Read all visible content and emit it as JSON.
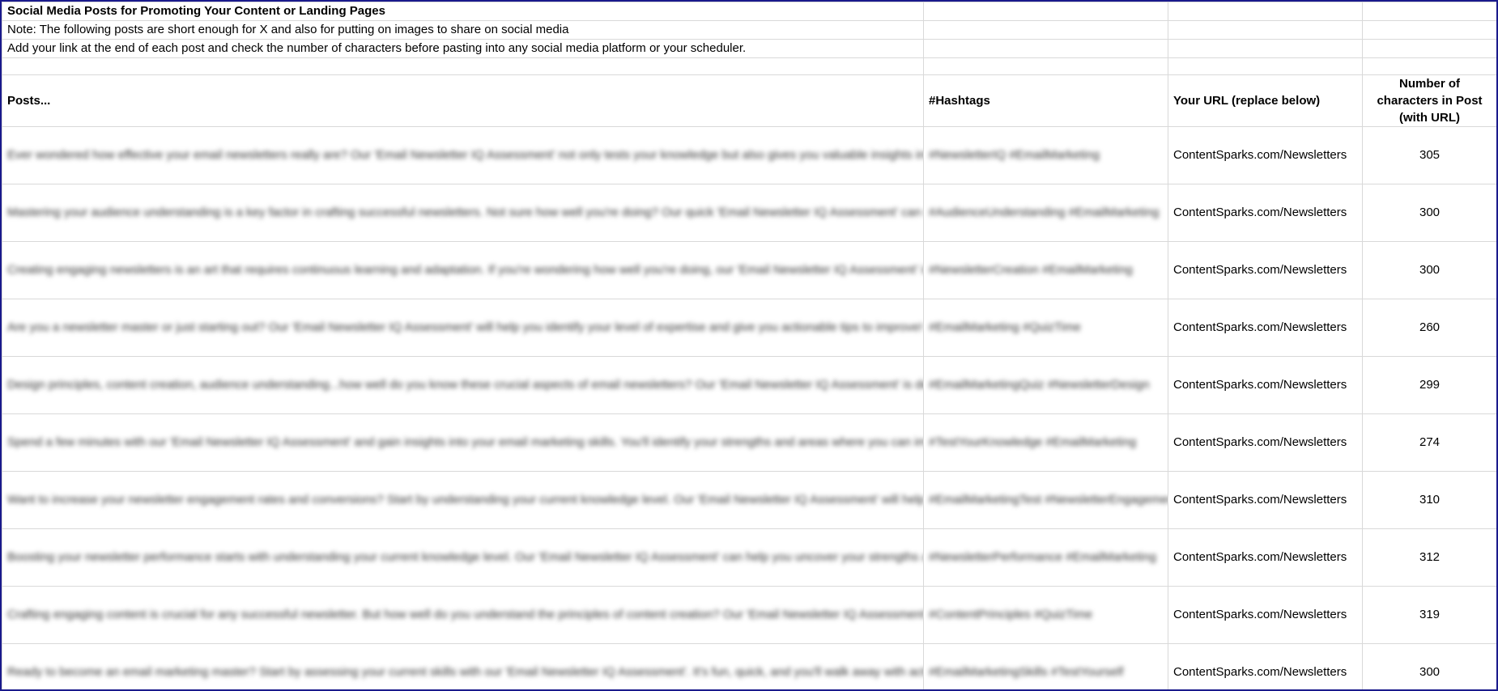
{
  "sheet": {
    "title": "Social Media Posts for Promoting Your Content or Landing Pages",
    "note1": "Note: The following posts are short enough for X and also for putting on images to share on social media",
    "note2": "Add your link at the end of each post and check the number of characters before pasting into any social media platform or your scheduler.",
    "headers": {
      "posts": "Posts...",
      "hashtags": "#Hashtags",
      "url": "Your URL (replace below)",
      "count": "Number of characters in Post (with URL)"
    },
    "rows": [
      {
        "post": "Ever wondered how effective your email newsletters really are? Our 'Email Newsletter IQ Assessment' not only tests your knowledge but also gives you valuable insights into creating newsletters that truly connect with your audience. Take it today!",
        "hashtags": "#NewsletterIQ #EmailMarketing",
        "url": "ContentSparks.com/Newsletters",
        "count": "305"
      },
      {
        "post": "Mastering your audience understanding is a key factor in crafting successful newsletters. Not sure how well you're doing? Our quick 'Email Newsletter IQ Assessment' can offer you a reality check and guide you towards improvement. Try it now!",
        "hashtags": "#AudienceUnderstanding #EmailMarketing",
        "url": "ContentSparks.com/Newsletters",
        "count": "300"
      },
      {
        "post": "Creating engaging newsletters is an art that requires continuous learning and adaptation. If you're wondering how well you're doing, our 'Email Newsletter IQ Assessment' is just for you. Test your knowledge and find areas to improve.",
        "hashtags": "#NewsletterCreation #EmailMarketing",
        "url": "ContentSparks.com/Newsletters",
        "count": "300"
      },
      {
        "post": "Are you a newsletter master or just starting out? Our 'Email Newsletter IQ Assessment' will help you identify your level of expertise and give you actionable tips to improve! Give it a go today.",
        "hashtags": "#EmailMarketing #QuizTime",
        "url": "ContentSparks.com/Newsletters",
        "count": "260"
      },
      {
        "post": "Design principles, content creation, audience understanding...how well do you know these crucial aspects of email newsletters? Our 'Email Newsletter IQ Assessment' is designed to test your knowledge and guide you on what to focus on. Try it now!",
        "hashtags": "#EmailMarketingQuiz #NewsletterDesign",
        "url": "ContentSparks.com/Newsletters",
        "count": "299"
      },
      {
        "post": "Spend a few minutes with our 'Email Newsletter IQ Assessment' and gain insights into your email marketing skills. You'll identify your strengths and areas where you can improve. Ready to take the challenge?",
        "hashtags": "#TestYourKnowledge #EmailMarketing",
        "url": "ContentSparks.com/Newsletters",
        "count": "274"
      },
      {
        "post": "Want to increase your newsletter engagement rates and conversions? Start by understanding your current knowledge level. Our 'Email Newsletter IQ Assessment' will help you do just that and guide you on your path to improvement. Check it out today!",
        "hashtags": "#EmailMarketingTest #NewsletterEngagement",
        "url": "ContentSparks.com/Newsletters",
        "count": "310"
      },
      {
        "post": "Boosting your newsletter performance starts with understanding your current knowledge level. Our 'Email Newsletter IQ Assessment' can help you uncover your strengths and areas for improvement. It's quick, easy, and insightful. Give it a try!",
        "hashtags": "#NewsletterPerformance #EmailMarketing",
        "url": "ContentSparks.com/Newsletters",
        "count": "312"
      },
      {
        "post": "Crafting engaging content is crucial for any successful newsletter. But how well do you understand the principles of content creation? Our 'Email Newsletter IQ Assessment' can help you find out. Dive in to discover your strengths and areas for growth.",
        "hashtags": "#ContentPrinciples #QuizTime",
        "url": "ContentSparks.com/Newsletters",
        "count": "319"
      },
      {
        "post": "Ready to become an email marketing master? Start by assessing your current skills with our 'Email Newsletter IQ Assessment'. It's fun, quick, and you'll walk away with actionable insights to improve your newsletters. What are you waiting for?",
        "hashtags": "#EmailMarketingSkills #TestYourself",
        "url": "ContentSparks.com/Newsletters",
        "count": "300"
      }
    ]
  }
}
